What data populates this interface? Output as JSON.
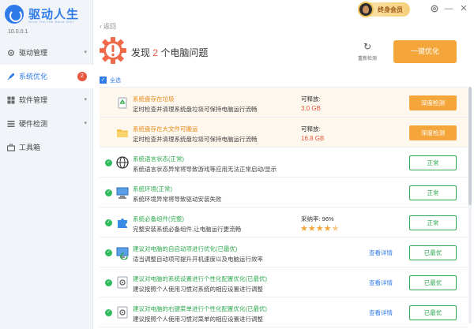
{
  "app": {
    "title": "驱动人生",
    "subtitle": "Drive The Life  Since 2007",
    "version": "10.0.0.1"
  },
  "titlebar": {
    "vip_label": "终身会员",
    "settings_icon": "gear-icon",
    "minimize": "—",
    "close": "✕"
  },
  "sidebar": {
    "items": [
      {
        "label": "驱动管理",
        "icon": "gear-icon",
        "caret": "▾"
      },
      {
        "label": "系统优化",
        "icon": "rocket-icon",
        "badge": "2",
        "active": true
      },
      {
        "label": "软件管理",
        "icon": "grid-icon",
        "caret": "▾"
      },
      {
        "label": "硬件检测",
        "icon": "list-icon",
        "caret": "▾"
      },
      {
        "label": "工具箱",
        "icon": "toolbox-icon"
      }
    ]
  },
  "header": {
    "back_label": "返回",
    "alert_prefix": "发现",
    "alert_count": "2",
    "alert_suffix": "个电脑问题",
    "refresh_label": "重新检测",
    "optimize_label": "一键优化"
  },
  "select_all_label": "全选",
  "rows": [
    {
      "status": "warn",
      "icon": "recycle-icon",
      "title": "系统盘存在垃圾",
      "desc": "定时检查并清理系统盘垃圾可保持电脑运行流畅",
      "metric_label": "可释放:",
      "metric_value": "3.0 GB",
      "button": "深度检测"
    },
    {
      "status": "warn",
      "icon": "folder-icon",
      "title": "系统盘存在大文件可搬运",
      "desc": "定时检查并清理系统盘垃圾可保持电脑运行流畅",
      "metric_label": "可释放:",
      "metric_value": "16.8 GB",
      "button": "深度检测"
    },
    {
      "status": "ok",
      "icon": "globe-icon",
      "title": "系统语言状态(正常)",
      "desc": "系统语言状态异常将导致游戏等应用无法正常启动/显示",
      "button": "正常"
    },
    {
      "status": "ok",
      "icon": "monitor-icon",
      "title": "系统环境(正常)",
      "desc": "系统环境异常将导致驱动安装失败",
      "button": "正常"
    },
    {
      "status": "ok",
      "icon": "puzzle-icon",
      "title": "系统必备组件(完整)",
      "desc": "完整安装系统必备组件,让电脑运行更流畅",
      "metric_label": "采纳率: 96%",
      "stars": 4.5,
      "button": "正常"
    },
    {
      "status": "ok",
      "icon": "startup-icon",
      "title": "建议对电脑的自启动项进行优化(已最优)",
      "desc": "适当调整自动项可提升开机速度以及电脑运行效率",
      "link": "查看详情",
      "button": "已最优"
    },
    {
      "status": "ok",
      "icon": "settings-file-icon",
      "title": "建议对电脑的系统设置进行个性化配置优化(已最优)",
      "desc": "建议按照个人使用习惯对系统的相应设置进行调整",
      "link": "查看详情",
      "button": "已最优"
    },
    {
      "status": "ok",
      "icon": "settings-file-icon",
      "title": "建议对电脑的右键菜单进行个性化配置优化(已最优)",
      "desc": "建议按照个人使用习惯对菜单的相应设置进行调整",
      "link": "查看详情",
      "button": "已最优"
    }
  ],
  "colors": {
    "accent": "#2f7ce8",
    "warn": "#f5a63a",
    "ok": "#2fa84f",
    "alert": "#e9563f"
  }
}
